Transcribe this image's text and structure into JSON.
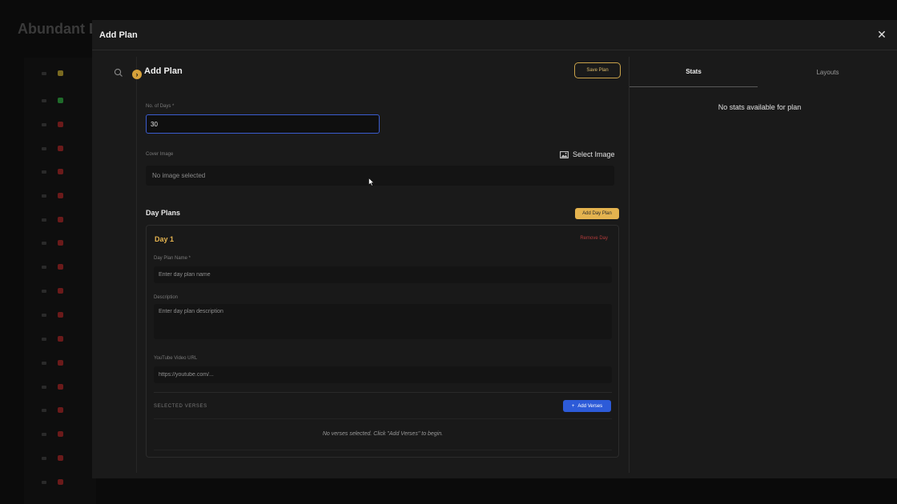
{
  "background": {
    "title": "Abundant Li"
  },
  "modal": {
    "title": "Add Plan",
    "close_icon": "close-icon",
    "left": {
      "title": "Add Plan",
      "save_label": "Save Plan",
      "days_label": "No. of Days *",
      "days_value": "30",
      "cover_label": "Cover Image",
      "select_image_label": "Select Image",
      "no_image_text": "No image selected",
      "day_plans_title": "Day Plans",
      "add_day_label": "Add Day Plan",
      "day": {
        "title": "Day 1",
        "remove_label": "Remove Day",
        "name_label": "Day Plan Name *",
        "name_placeholder": "Enter day plan name",
        "description_label": "Description",
        "description_placeholder": "Enter day plan description",
        "youtube_label": "YouTube Video URL",
        "youtube_placeholder": "https://youtube.com/...",
        "selected_verses_label": "SELECTED VERSES",
        "add_verses_label": "Add Verses",
        "no_verses_text": "No verses selected. Click \"Add Verses\" to begin."
      }
    },
    "right": {
      "tabs": [
        {
          "label": "Stats",
          "active": true
        },
        {
          "label": "Layouts",
          "active": false
        }
      ],
      "no_stats_text": "No stats available for plan"
    }
  },
  "colors": {
    "accent_gold": "#e4b34f",
    "primary_blue": "#2d5bd8",
    "danger_red": "#b23a3a",
    "modal_bg": "#1a1a1a"
  }
}
